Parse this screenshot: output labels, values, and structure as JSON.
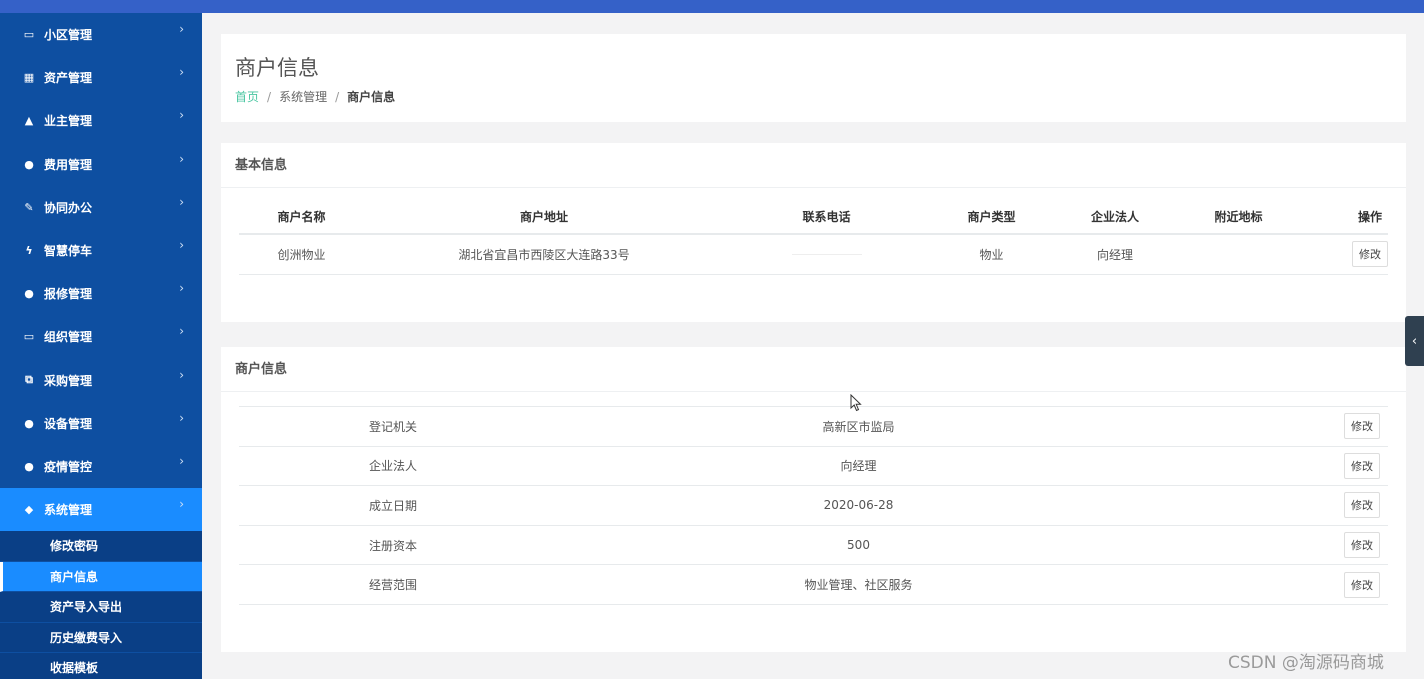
{
  "sidebar": {
    "items": [
      {
        "icon": "laptop-icon",
        "glyph": "▭",
        "label": "小区管理"
      },
      {
        "icon": "grid-icon",
        "glyph": "▦",
        "label": "资产管理"
      },
      {
        "icon": "flask-icon",
        "glyph": "▲",
        "label": "业主管理"
      },
      {
        "icon": "globe-icon",
        "glyph": "●",
        "label": "费用管理"
      },
      {
        "icon": "edit-icon",
        "glyph": "✎",
        "label": "协同办公"
      },
      {
        "icon": "bolt-icon",
        "glyph": "ϟ",
        "label": "智慧停车"
      },
      {
        "icon": "globe-icon",
        "glyph": "●",
        "label": "报修管理"
      },
      {
        "icon": "desktop-icon",
        "glyph": "▭",
        "label": "组织管理"
      },
      {
        "icon": "copy-icon",
        "glyph": "⧉",
        "label": "采购管理"
      },
      {
        "icon": "globe-icon",
        "glyph": "●",
        "label": "设备管理"
      },
      {
        "icon": "globe-icon",
        "glyph": "●",
        "label": "疫情管控"
      },
      {
        "icon": "diamond-icon",
        "glyph": "◆",
        "label": "系统管理"
      }
    ],
    "chevron": "›",
    "subitems": [
      "修改密码",
      "商户信息",
      "资产导入导出",
      "历史缴费导入",
      "收据模板"
    ]
  },
  "header": {
    "title": "商户信息",
    "breadcrumb": {
      "home": "首页",
      "sep": "/",
      "middle": "系统管理",
      "current": "商户信息"
    }
  },
  "basic_info": {
    "title": "基本信息",
    "columns": [
      "商户名称",
      "商户地址",
      "联系电话",
      "商户类型",
      "企业法人",
      "附近地标",
      "操作"
    ],
    "row": {
      "name": "创洲物业",
      "address": "湖北省宜昌市西陵区大连路33号",
      "phone": "",
      "type": "物业",
      "legal_person": "向经理",
      "landmark": "",
      "action": "修改"
    }
  },
  "merchant_info": {
    "title": "商户信息",
    "rows": [
      {
        "label": "登记机关",
        "value": "高新区市监局",
        "action": "修改"
      },
      {
        "label": "企业法人",
        "value": "向经理",
        "action": "修改"
      },
      {
        "label": "成立日期",
        "value": "2020-06-28",
        "action": "修改"
      },
      {
        "label": "注册资本",
        "value": "500",
        "action": "修改"
      },
      {
        "label": "经营范围",
        "value": "物业管理、社区服务",
        "action": "修改"
      }
    ]
  },
  "collapse_tab": {
    "glyph": "‹"
  },
  "watermark": "CSDN @淘源码商城"
}
